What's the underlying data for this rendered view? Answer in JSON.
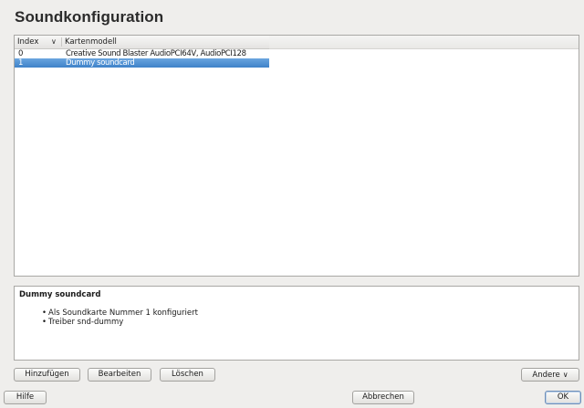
{
  "page": {
    "title": "Soundkonfiguration"
  },
  "table": {
    "columns": [
      "Index",
      "Kartenmodell"
    ],
    "sort_indicator": "∨",
    "rows": [
      {
        "index": "0",
        "model": "Creative Sound Blaster AudioPCI64V, AudioPCI128",
        "selected": false
      },
      {
        "index": "1",
        "model": "Dummy soundcard",
        "selected": true
      }
    ]
  },
  "details": {
    "heading": "Dummy soundcard",
    "items": [
      "Als Soundkarte Nummer 1 konfiguriert",
      "Treiber snd-dummy"
    ]
  },
  "actions": {
    "add": "Hinzufügen",
    "edit": "Bearbeiten",
    "delete": "Löschen",
    "other": "Andere",
    "other_chevron": "∨"
  },
  "footer": {
    "help": "Hilfe",
    "cancel": "Abbrechen",
    "ok": "OK"
  }
}
